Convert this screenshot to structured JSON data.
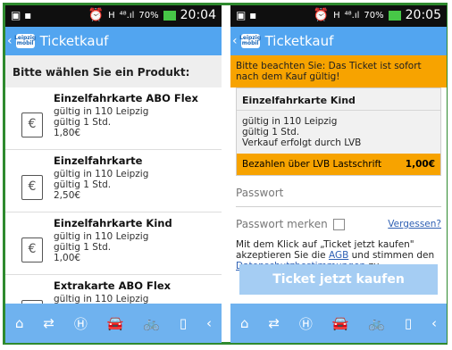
{
  "left": {
    "status": {
      "icons": "▣ ▪",
      "alarm": "⏰",
      "h": "H",
      "signal": "⁴⁸.ıl",
      "battery_pct": "70%",
      "time": "20:04"
    },
    "appbar": {
      "logo_top": "Leipzig",
      "logo_bottom": "mobil",
      "title": "Ticketkauf"
    },
    "section_title": "Bitte wählen Sie ein Produkt:",
    "products": [
      {
        "name": "Einzelfahrkarte ABO Flex",
        "line1": "gültig in 110 Leipzig",
        "line2": "gültig 1 Std.",
        "price": "1,80€"
      },
      {
        "name": "Einzelfahrkarte",
        "line1": "gültig in 110 Leipzig",
        "line2": "gültig 1 Std.",
        "price": "2,50€"
      },
      {
        "name": "Einzelfahrkarte Kind",
        "line1": "gültig in 110 Leipzig",
        "line2": "gültig 1 Std.",
        "price": "1,00€"
      },
      {
        "name": "Extrakarte ABO Flex",
        "line1": "gültig in 110 Leipzig",
        "line2": "",
        "price": ""
      }
    ]
  },
  "right": {
    "status": {
      "icons": "▣ ▪",
      "alarm": "⏰",
      "h": "H",
      "signal": "⁴⁸.ıl",
      "battery_pct": "70%",
      "time": "20:05"
    },
    "appbar": {
      "logo_top": "Leipzig",
      "logo_bottom": "mobil",
      "title": "Ticketkauf"
    },
    "notice": "Bitte beachten Sie: Das Ticket ist sofort nach dem Kauf gültig!",
    "card": {
      "title": "Einzelfahrkarte Kind",
      "line1": "gültig in 110 Leipzig",
      "line2": "gültig 1 Std.",
      "line3": "Verkauf erfolgt durch LVB",
      "pay_label": "Bezahlen über LVB Lastschrift",
      "pay_amount": "1,00€"
    },
    "password_placeholder": "Passwort",
    "remember_label": "Passwort merken",
    "forgot_label": "Vergessen?",
    "consent": {
      "pre": "Mit dem Klick auf „Ticket jetzt kaufen\" akzeptieren Sie die ",
      "agb": "AGB",
      "mid": " und stimmen den ",
      "privacy": "Datenschutzbestimmungen",
      "post": " zu."
    },
    "buy_button": "Ticket jetzt kaufen"
  },
  "bottom_nav": [
    "home-icon",
    "map-icon",
    "stop-icon",
    "car-icon",
    "bike-icon",
    "ticket-icon",
    "back-icon"
  ]
}
